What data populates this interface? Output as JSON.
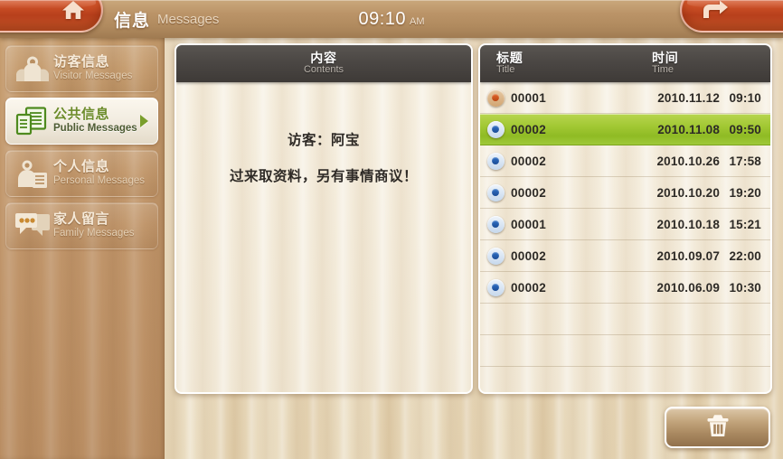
{
  "topbar": {
    "home_icon": "home-icon",
    "back_icon": "return-arrow-icon",
    "title_cn": "信息",
    "title_en": "Messages",
    "clock_time": "09:10",
    "clock_ampm": "AM"
  },
  "sidebar": {
    "items": [
      {
        "cn": "访客信息",
        "en": "Visitor Messages",
        "icon": "visitor-camera-icon",
        "active": false
      },
      {
        "cn": "公共信息",
        "en": "Public Messages",
        "icon": "public-document-icon",
        "active": true
      },
      {
        "cn": "个人信息",
        "en": "Personal Messages",
        "icon": "person-document-icon",
        "active": false
      },
      {
        "cn": "家人留言",
        "en": "Family Messages",
        "icon": "speech-bubble-icon",
        "active": false
      }
    ]
  },
  "contents_panel": {
    "head_cn": "内容",
    "head_en": "Contents",
    "line1": "访客：阿宝",
    "line2": "过来取资料，另有事情商议！"
  },
  "list_panel": {
    "head_title_cn": "标题",
    "head_title_en": "Title",
    "head_time_cn": "时间",
    "head_time_en": "Time",
    "rows": [
      {
        "title": "00001",
        "date": "2010.11.12",
        "time": "09:10",
        "state": "unread",
        "selected": false
      },
      {
        "title": "00002",
        "date": "2010.11.08",
        "time": "09:50",
        "state": "read",
        "selected": true
      },
      {
        "title": "00002",
        "date": "2010.10.26",
        "time": "17:58",
        "state": "read",
        "selected": false
      },
      {
        "title": "00002",
        "date": "2010.10.20",
        "time": "19:20",
        "state": "read",
        "selected": false
      },
      {
        "title": "00001",
        "date": "2010.10.18",
        "time": "15:21",
        "state": "read",
        "selected": false
      },
      {
        "title": "00002",
        "date": "2010.09.07",
        "time": "22:00",
        "state": "read",
        "selected": false
      },
      {
        "title": "00002",
        "date": "2010.06.09",
        "time": "10:30",
        "state": "read",
        "selected": false
      }
    ],
    "empty_rows": 3
  },
  "delete_button": {
    "icon": "trash-icon"
  },
  "colors": {
    "accent_orange": "#c8522a",
    "selected_green": "#9fc93a",
    "panel_header": "#4b4744",
    "sidebar_wood": "#c0956a",
    "background_wood": "#ecdfc4",
    "unread_dot": "#d4541a",
    "read_dot": "#1f58a8"
  }
}
